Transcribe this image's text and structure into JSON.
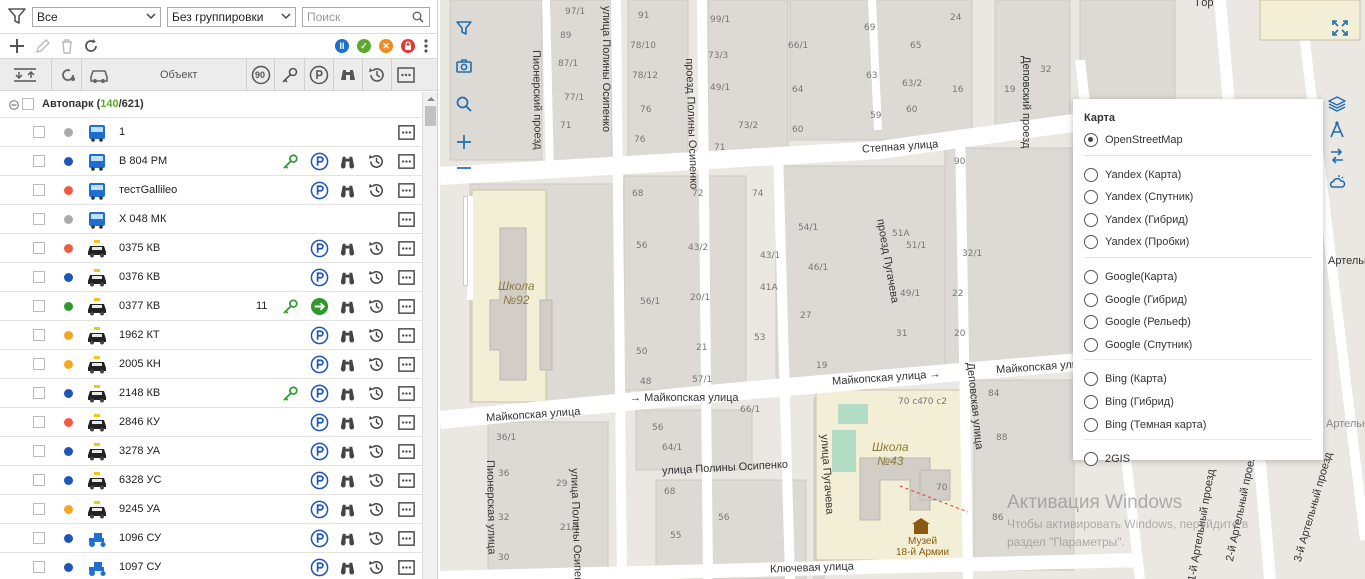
{
  "filters": {
    "all_select": "Все",
    "group_select": "Без группировки",
    "search_placeholder": "Поиск"
  },
  "header": {
    "object_label": "Объект",
    "speed_badge": "90"
  },
  "tree": {
    "root_label": "Автопарк",
    "root_online": "140",
    "root_total": "621"
  },
  "vehicles": [
    {
      "name": "1",
      "status_color": "#aaaaaa",
      "type": "bus",
      "key": false,
      "parking": false,
      "binoculars": false,
      "history": false,
      "moving": false,
      "count": ""
    },
    {
      "name": "В 804 РМ",
      "status_color": "#1e56b8",
      "type": "bus",
      "key": true,
      "parking": true,
      "binoculars": true,
      "history": true,
      "moving": false,
      "count": ""
    },
    {
      "name": "тестGallileo",
      "status_color": "#f05a40",
      "type": "bus",
      "key": false,
      "parking": true,
      "binoculars": true,
      "history": true,
      "moving": false,
      "count": ""
    },
    {
      "name": "Х 048 МК",
      "status_color": "#aaaaaa",
      "type": "bus",
      "key": false,
      "parking": false,
      "binoculars": false,
      "history": false,
      "moving": false,
      "count": ""
    },
    {
      "name": "0375 КВ",
      "status_color": "#f05a40",
      "type": "taxi",
      "key": false,
      "parking": true,
      "binoculars": true,
      "history": true,
      "moving": false,
      "count": ""
    },
    {
      "name": "0376 КВ",
      "status_color": "#1e56b8",
      "type": "taxi",
      "key": false,
      "parking": true,
      "binoculars": true,
      "history": true,
      "moving": false,
      "count": ""
    },
    {
      "name": "0377 КВ",
      "status_color": "#2e9a2e",
      "type": "taxi",
      "key": true,
      "parking": false,
      "binoculars": true,
      "history": true,
      "moving": true,
      "count": "11"
    },
    {
      "name": "1962 КТ",
      "status_color": "#f5a623",
      "type": "taxi",
      "key": false,
      "parking": true,
      "binoculars": true,
      "history": true,
      "moving": false,
      "count": ""
    },
    {
      "name": "2005 КН",
      "status_color": "#f5a623",
      "type": "taxi",
      "key": false,
      "parking": true,
      "binoculars": true,
      "history": true,
      "moving": false,
      "count": ""
    },
    {
      "name": "2148 КВ",
      "status_color": "#1e56b8",
      "type": "taxi",
      "key": true,
      "parking": true,
      "binoculars": true,
      "history": true,
      "moving": false,
      "count": ""
    },
    {
      "name": "2846 КУ",
      "status_color": "#f05a40",
      "type": "taxi",
      "key": false,
      "parking": true,
      "binoculars": true,
      "history": true,
      "moving": false,
      "count": ""
    },
    {
      "name": "3278 УА",
      "status_color": "#1e56b8",
      "type": "taxi",
      "key": false,
      "parking": true,
      "binoculars": true,
      "history": true,
      "moving": false,
      "count": ""
    },
    {
      "name": "6328 УС",
      "status_color": "#1e56b8",
      "type": "taxi",
      "key": false,
      "parking": true,
      "binoculars": true,
      "history": true,
      "moving": false,
      "count": ""
    },
    {
      "name": "9245 УА",
      "status_color": "#f5a623",
      "type": "taxi",
      "key": false,
      "parking": true,
      "binoculars": true,
      "history": true,
      "moving": false,
      "count": ""
    },
    {
      "name": "1096 СУ",
      "status_color": "#1e56b8",
      "type": "tractor",
      "key": false,
      "parking": true,
      "binoculars": true,
      "history": true,
      "moving": false,
      "count": ""
    },
    {
      "name": "1097 СУ",
      "status_color": "#1e56b8",
      "type": "tractor",
      "key": false,
      "parking": true,
      "binoculars": true,
      "history": true,
      "moving": false,
      "count": ""
    }
  ],
  "layers": {
    "title": "Карта",
    "groups": [
      {
        "options": [
          "OpenStreetMap"
        ]
      },
      {
        "options": [
          "Yandex (Карта)",
          "Yandex (Спутник)",
          "Yandex (Гибрид)",
          "Yandex (Пробки)"
        ]
      },
      {
        "options": [
          "Google(Карта)",
          "Google (Гибрид)",
          "Google (Рельеф)",
          "Google (Спутник)"
        ]
      },
      {
        "options": [
          "Bing (Карта)",
          "Bing (Гибрид)",
          "Bing (Темная карта)"
        ]
      },
      {
        "options": [
          "2GIS"
        ]
      }
    ],
    "selected": "OpenStreetMap"
  },
  "map": {
    "streets": {
      "stepnaya": "Степная улица",
      "maikopskaya_left": "Майкопская улица",
      "maikopskaya_mid": "Майкопская улица",
      "maikopskaya_center": "Майкопская улица",
      "maikopskaya_right": "Майкопская улица",
      "osipenko": "улица Полины Осипенко",
      "osipenko_v": "улица Полины Осипенко",
      "osipenko_pr": "проезд Полины Осипенко",
      "osipenko_top": "улица Полины Осипенко",
      "pionerskiy_pr": "Пионерский проезд",
      "pionerskaya": "Пионерская улица",
      "pugacheva_pr": "проезд Пугачева",
      "pugacheva": "улица Пугачева",
      "depovskiy_pr": "Деповский проезд",
      "depovskaya": "Деповская улица",
      "klyuchevaya": "Ключевая улица",
      "artelnaya1": "1-й Артельный проезд",
      "artelnaya2": "2-й Артельный проезд",
      "artelnaya3": "3-й Артельный проезд",
      "artelnaya_ul": "Артельная улица",
      "artelnaya_top": "Артельна",
      "gor": "Гор"
    },
    "places": {
      "school92": "Школа\n№92",
      "school43": "Школа\n№43",
      "museum": "Музей\n18-й Армии"
    },
    "watermark": {
      "line1": "Активация Windows",
      "line2": "Чтобы активировать Windows, перейдите в",
      "line3": "раздел \"Параметры\"."
    }
  }
}
